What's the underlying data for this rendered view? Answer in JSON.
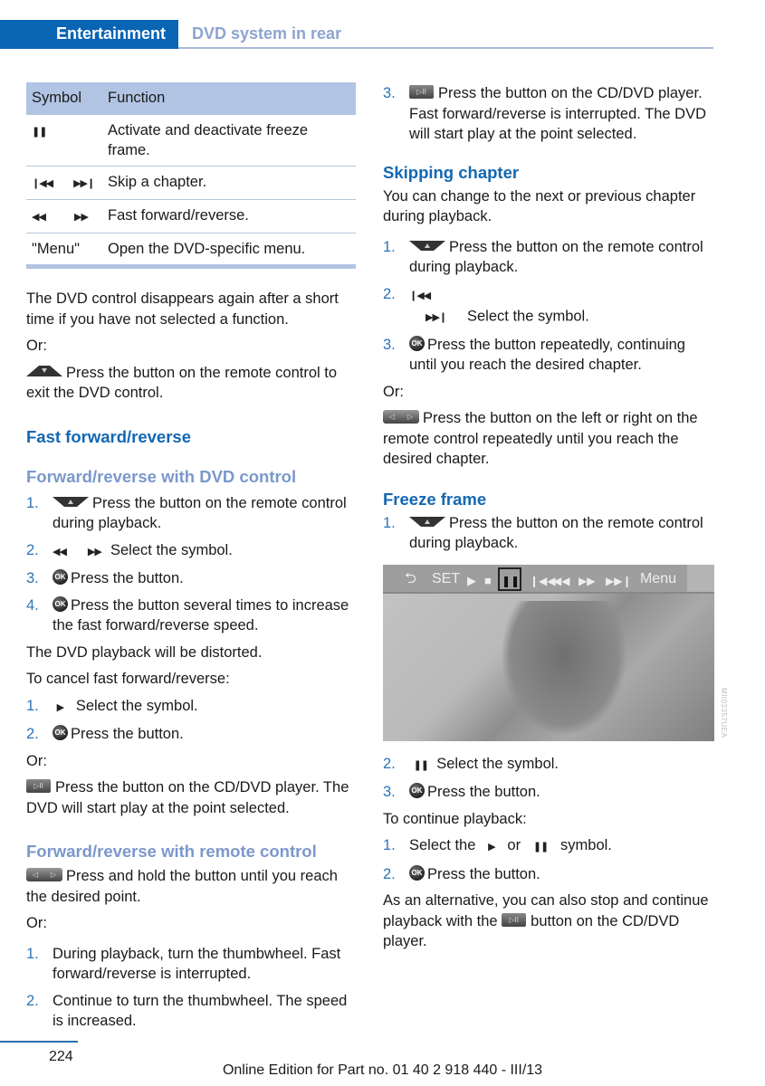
{
  "header": {
    "chapter": "Entertainment",
    "section": "DVD system in rear"
  },
  "table": {
    "headers": [
      "Symbol",
      "Function"
    ],
    "rows": [
      {
        "symbols": [
          "❚❚"
        ],
        "function": "Activate and deactivate freeze frame."
      },
      {
        "symbols": [
          "❙◀◀",
          "▶▶❙"
        ],
        "function": "Skip a chapter."
      },
      {
        "symbols": [
          "◀◀",
          "▶▶"
        ],
        "function": "Fast forward/reverse."
      },
      {
        "symbols": [
          "\"Menu\""
        ],
        "function": "Open the DVD-specific menu."
      }
    ]
  },
  "left": {
    "p1": "The DVD control disappears again after a short time if you have not selected a function.",
    "or": "Or:",
    "p2": "Press the button on the remote control to exit the DVD control.",
    "h_ff": "Fast forward/reverse",
    "h_dvd": "Forward/reverse with DVD control",
    "dvd_steps": [
      {
        "num": "1.",
        "text": "Press the button on the remote control during playback."
      },
      {
        "num": "2.",
        "text": "Select the symbol."
      },
      {
        "num": "3.",
        "text": "Press the button."
      },
      {
        "num": "4.",
        "text": "Press the button several times to increase the fast forward/reverse speed."
      }
    ],
    "distorted": "The DVD playback will be distorted.",
    "cancel": "To cancel fast forward/reverse:",
    "cancel_steps": [
      {
        "num": "1.",
        "text": "Select the symbol."
      },
      {
        "num": "2.",
        "text": "Press the button."
      }
    ],
    "cd_press": "Press the button on the CD/DVD player. The DVD will start play at the point selected.",
    "h_remote": "Forward/reverse with remote control",
    "hold": "Press and hold the button until you reach the desired point.",
    "thumb_steps": [
      {
        "num": "1.",
        "text": "During playback, turn the thumbwheel. Fast forward/reverse is interrupted."
      },
      {
        "num": "2.",
        "text": "Continue to turn the thumbwheel. The speed is increased."
      }
    ]
  },
  "right": {
    "step3": {
      "num": "3.",
      "text": "Press the button on the CD/DVD player. Fast forward/reverse is interrupted. The DVD will start play at the point selected."
    },
    "h_skip": "Skipping chapter",
    "skip_intro": "You can change to the next or previous chapter during playback.",
    "skip_steps": [
      {
        "num": "1.",
        "text": "Press the button on the remote control during playback."
      },
      {
        "num": "2.",
        "text": "Select the symbol."
      },
      {
        "num": "3.",
        "text": "Press the button repeatedly, continuing until you reach the desired chapter."
      }
    ],
    "or": "Or:",
    "lr_press": "Press the button on the left or right on the remote control repeatedly until you reach the desired chapter.",
    "h_freeze": "Freeze frame",
    "freeze_step1": {
      "num": "1.",
      "text": "Press the button on the remote control during playback."
    },
    "screen": {
      "bar": [
        "⮌",
        "SET",
        "▶",
        "■",
        "❚❚",
        "❙◀◀",
        "◀◀",
        "▶▶",
        "▶▶❙",
        "Menu"
      ],
      "code": "MII03357UEA"
    },
    "freeze_steps": [
      {
        "num": "2.",
        "text": "Select the symbol."
      },
      {
        "num": "3.",
        "text": "Press the button."
      }
    ],
    "continue": "To continue playback:",
    "cont_steps": [
      {
        "num": "1.",
        "pre": "Select the",
        "mid": "or",
        "post": "symbol."
      },
      {
        "num": "2.",
        "text": "Press the button."
      }
    ],
    "alt_pre": "As an alternative, you can also stop and continue playback with the",
    "alt_post": "button on the CD/DVD player."
  },
  "icons": {
    "ok": "OK",
    "cd": "▷II",
    "left": "◁",
    "right": "▷",
    "play": "▶",
    "pause": "❚❚"
  },
  "footer": {
    "page": "224",
    "edition": "Online Edition for Part no. 01 40 2 918 440 - III/13"
  }
}
